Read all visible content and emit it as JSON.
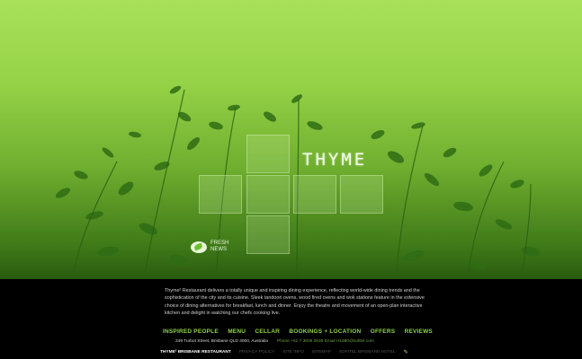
{
  "logo": {
    "text": "THYME"
  },
  "fresh_news": {
    "line1": "FRESH",
    "line2": "NEWS"
  },
  "description": "Thyme² Restaurant delivers a totally unique and inspiring dining experience, reflecting world-wide dining trends and the sophistication of the city and its cuisine. Sleek tandoori ovens, wood fired ovens and wok stations feature in the extensive choice of dining alternatives for breakfast, lunch and dinner. Enjoy the theatre and movement of an open-plan interactive kitchen and delight in watching our chefs cooking live.",
  "nav": [
    "INSPIRED PEOPLE",
    "MENU",
    "CELLAR",
    "BOOKINGS + LOCATION",
    "OFFERS",
    "REVIEWS"
  ],
  "address": {
    "street": "249 Turbot Street, Brisbane QLD 4000, Australia",
    "contact": "Phone +61 7 3835 3535   Email H1980@sofitel.com"
  },
  "bottom": {
    "brand": "THYME² BRISBANE RESTAURANT",
    "links": [
      "PRIVACY POLICY",
      "SITE INFO",
      "SITEMAP",
      "SOFITEL BRISBANE HOTEL"
    ]
  },
  "colors": {
    "accent_green": "#8fd14a",
    "background": "#000000"
  }
}
